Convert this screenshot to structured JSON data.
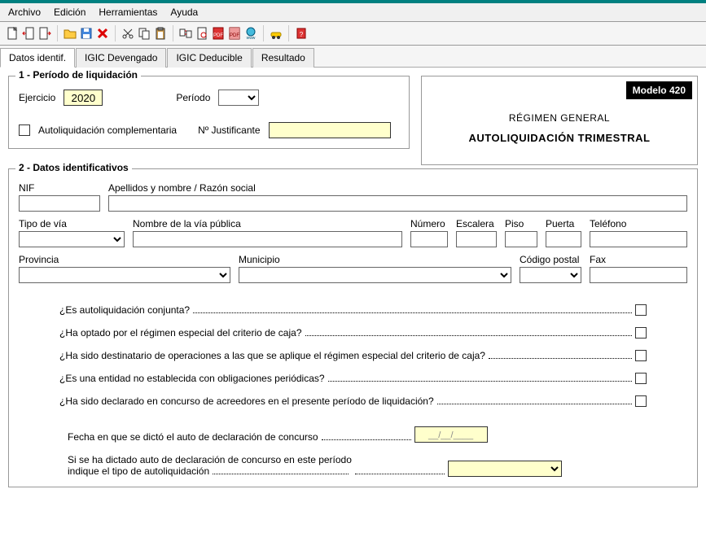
{
  "menu": {
    "items": [
      "Archivo",
      "Edición",
      "Herramientas",
      "Ayuda"
    ]
  },
  "toolbar": {
    "icons": [
      "doc-new",
      "doc-move-left",
      "doc-move-right",
      "folder-open",
      "disk-save",
      "delete-x",
      "scissors-cut",
      "copy",
      "paste",
      "swap-docs",
      "file-stamp",
      "pdf-red",
      "pdf-gray",
      "globe-www",
      "car-yellow",
      "help-book"
    ],
    "separators_after": [
      2,
      5,
      8,
      13,
      14
    ]
  },
  "tabs": [
    {
      "label": "Datos identif.",
      "active": true
    },
    {
      "label": "IGIC Devengado",
      "active": false
    },
    {
      "label": "IGIC Deducible",
      "active": false
    },
    {
      "label": "Resultado",
      "active": false
    }
  ],
  "section1": {
    "legend": "1 - Período de liquidación",
    "ejercicio_label": "Ejercicio",
    "ejercicio_value": "2020",
    "periodo_label": "Período",
    "periodo_value": "",
    "complementaria_label": "Autoliquidación complementaria",
    "justificante_label": "Nº Justificante",
    "justificante_value": ""
  },
  "header_box": {
    "modelo_badge": "Modelo 420",
    "regimen": "RÉGIMEN GENERAL",
    "titulo": "AUTOLIQUIDACIÓN TRIMESTRAL"
  },
  "section2": {
    "legend": "2 - Datos identificativos",
    "nif_label": "NIF",
    "nombre_label": "Apellidos y nombre / Razón social",
    "tipo_via_label": "Tipo de vía",
    "via_label": "Nombre de la vía pública",
    "numero_label": "Número",
    "escalera_label": "Escalera",
    "piso_label": "Piso",
    "puerta_label": "Puerta",
    "telefono_label": "Teléfono",
    "provincia_label": "Provincia",
    "municipio_label": "Municipio",
    "cp_label": "Código postal",
    "fax_label": "Fax",
    "questions": [
      "¿Es autoliquidación conjunta?",
      "¿Ha optado por el régimen especial del criterio de caja?",
      "¿Ha sido destinatario de operaciones a las que se aplique el régimen especial del criterio de caja?",
      "¿Es una entidad no establecida con obligaciones periódicas?",
      "¿Ha sido declarado en concurso de acreedores en el presente período de liquidación?"
    ],
    "fecha_auto_label": "Fecha en que se dictó el auto de declaración de concurso",
    "fecha_auto_placeholder": "__/__/____",
    "tipo_auto_label_l1": "Si se ha dictado auto de declaración de concurso en este período",
    "tipo_auto_label_l2": "indique el tipo de autoliquidación"
  }
}
